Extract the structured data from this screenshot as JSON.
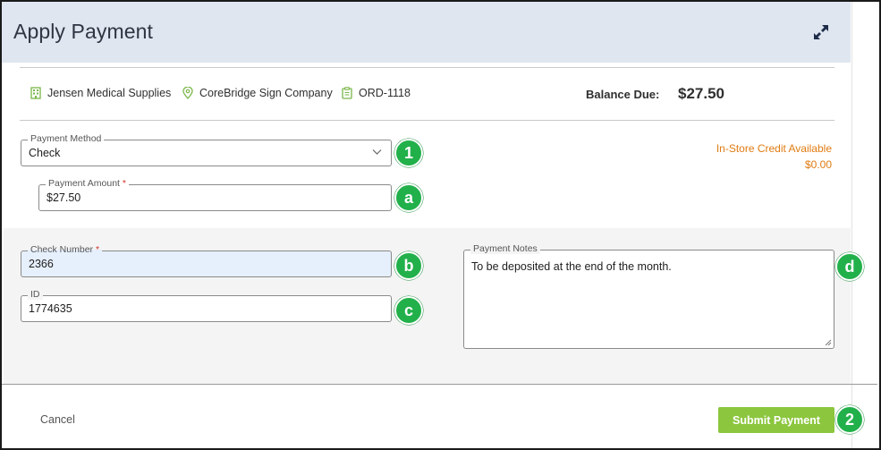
{
  "header": {
    "title": "Apply Payment",
    "expand_icon": "expand-arrows-icon"
  },
  "info": {
    "company": {
      "label": "Jensen Medical Supplies",
      "icon": "building-icon"
    },
    "location": {
      "label": "CoreBridge Sign Company",
      "icon": "map-pin-icon"
    },
    "order": {
      "label": "ORD-1118",
      "icon": "clipboard-icon"
    }
  },
  "balance": {
    "label": "Balance Due:",
    "value": "$27.50"
  },
  "credit": {
    "title": "In-Store Credit Available",
    "value": "$0.00",
    "color": "#e07b12"
  },
  "payment_method": {
    "label": "Payment Method",
    "value": "Check"
  },
  "payment_amount": {
    "label": "Payment Amount",
    "required_mark": "*",
    "value": "$27.50"
  },
  "check_number": {
    "label": "Check Number",
    "required_mark": "*",
    "value": "2366"
  },
  "id_field": {
    "label": "ID",
    "value": "1774635"
  },
  "notes": {
    "label": "Payment Notes",
    "value": "To be deposited at the end of the month."
  },
  "callouts": {
    "one": "1",
    "a": "a",
    "b": "b",
    "c": "c",
    "d": "d",
    "two": "2"
  },
  "footer": {
    "cancel_label": "Cancel",
    "submit_label": "Submit Payment"
  },
  "colors": {
    "header_bg": "#dfe6f0",
    "accent_green": "#8cc63e",
    "badge_green": "#22b04b",
    "icon_green": "#7ab648"
  }
}
